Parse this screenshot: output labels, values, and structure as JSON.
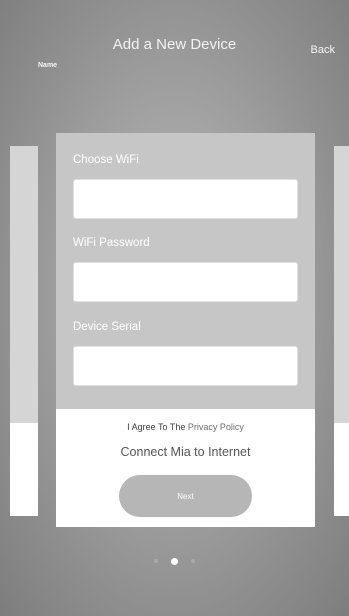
{
  "header": {
    "title": "Add a New Device",
    "name_label": "Name",
    "back_label": "Back"
  },
  "form": {
    "wifi_label": "Choose WiFi",
    "wifi_value": "",
    "password_label": "WiFi Password",
    "password_value": "",
    "serial_label": "Device Serial",
    "serial_value": "",
    "agree_prefix": "I Agree To The",
    "privacy_link": "Privacy Policy",
    "connect_text": "Connect Mia to Internet",
    "next_label": "Next"
  },
  "pager": {
    "total": 3,
    "active_index": 1
  },
  "colors": {
    "card_top": "#c6c6c6",
    "button": "#b6b6b6",
    "background": "#9a9a9a"
  }
}
